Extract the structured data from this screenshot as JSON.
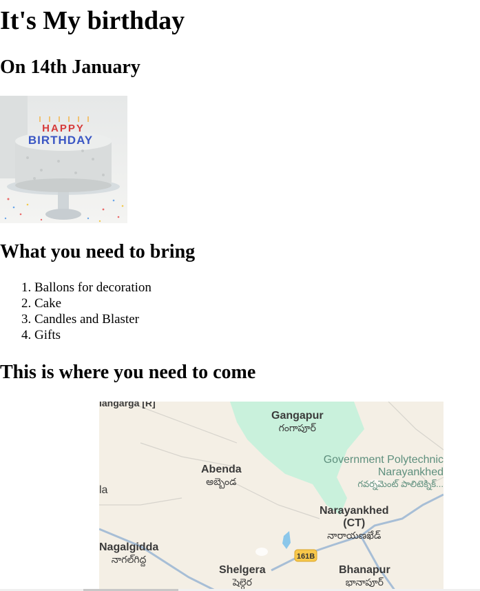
{
  "page": {
    "title": "It's My birthday",
    "subtitle": "On 14th January",
    "need_heading": "What you need to bring",
    "come_heading": "This is where you need to come"
  },
  "cake_image": {
    "top_line": "HAPPY",
    "bottom_line": "BIRTHDAY"
  },
  "bring_list": [
    "Ballons for decoration",
    "Cake",
    "Candles and Blaster",
    "Gifts"
  ],
  "map": {
    "places": {
      "top_left_cut": "iangarga [R]",
      "gangapur": {
        "en": "Gangapur",
        "te": "గంగాపూర్"
      },
      "polytechnic": {
        "en1": "Government Polytechnic",
        "en2": "Narayankhed",
        "te": "గవర్నమెంట్ పాలిటెక్నిక్..."
      },
      "abenda": {
        "en": "Abenda",
        "te": "అబ్బెండ"
      },
      "left_cut": "la",
      "narayankhed": {
        "en1": "Narayankhed",
        "en2": "(CT)",
        "te": "నారాయణఖేడ్"
      },
      "nagalgidda": {
        "en": "Nagalgidda",
        "te": "నాగల్‌గిద్ద"
      },
      "shelgera": {
        "en": "Shelgera",
        "te": "షెల్గెర"
      },
      "bhanapur": {
        "en": "Bhanapur",
        "te": "భానాపూర్"
      }
    },
    "road_shield": "161B",
    "colors": {
      "land": "#f4efe5",
      "green": "#c9f1dc",
      "road": "#a7bed6",
      "highway": "#f8c84a",
      "water": "#8bc7ea"
    }
  }
}
